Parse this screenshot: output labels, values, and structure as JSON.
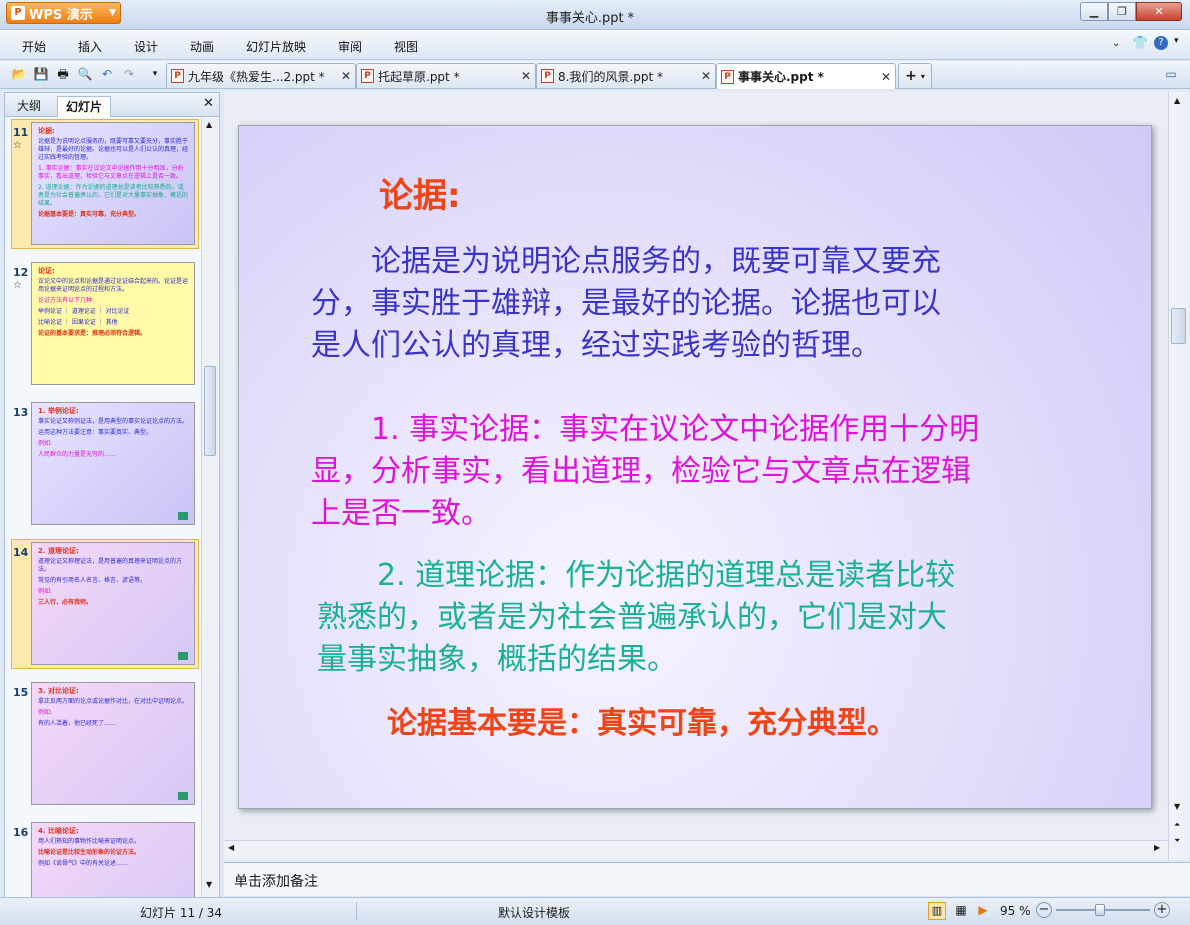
{
  "app": {
    "brand": "WPS 演示",
    "window_title": "事事关心.ppt *"
  },
  "menu": [
    "开始",
    "插入",
    "设计",
    "动画",
    "幻灯片放映",
    "审阅",
    "视图"
  ],
  "doc_tabs": [
    {
      "label": "九年级《热爱生...2.ppt *"
    },
    {
      "label": "托起草原.ppt *"
    },
    {
      "label": "8.我们的风景.ppt *"
    },
    {
      "label": "事事关心.ppt *",
      "active": true
    }
  ],
  "left_pane": {
    "tabs": [
      "大纲",
      "幻灯片"
    ],
    "thumbnails": [
      {
        "num": "11",
        "star": "☆",
        "selected": true,
        "lines": [
          {
            "c": "th",
            "t": "论据:"
          },
          {
            "c": "tb1",
            "t": "论据是为说明论点服务的，既要可靠又要充分，事实胜于雄辩，是最好的论据。论据也可以是人们公认的真理，经过实践考验的哲理。"
          },
          {
            "c": "tb2",
            "t": "1. 事实论据：事实在议论文中论据作用十分明显，分析事实，看出道理，检验它与文章点在逻辑上是否一致。"
          },
          {
            "c": "tb3",
            "t": "2. 道理论据：作为论据的道理总是读者比较熟悉的，或者是为社会普遍承认的，它们是对大量事实抽象，概括的结果。"
          },
          {
            "c": "tb4",
            "t": "论据基本要是：真实可靠，充分典型。"
          }
        ]
      },
      {
        "num": "12",
        "star": "☆",
        "lines": [
          {
            "c": "th",
            "t": "论证:"
          },
          {
            "c": "tb1",
            "t": "议论文中的论点和论据是通过论证结合起来的。论证是运用论据来证明论点的过程和方法。"
          },
          {
            "c": "tb2",
            "t": "论证方法有以下几种:"
          },
          {
            "c": "tb1",
            "t": "举例论证 ｜ 道理论证 ｜ 对比论证"
          },
          {
            "c": "tb1",
            "t": "比喻论证 ｜ 因果论证 ｜ 其他"
          },
          {
            "c": "tb4",
            "t": "论证的基本要求是：推理必须符合逻辑。"
          }
        ]
      },
      {
        "num": "13",
        "lines": [
          {
            "c": "th",
            "t": "1. 举例论证:"
          },
          {
            "c": "tb1",
            "t": "事实论证又称例证法，是用典型的事实论证论点的方法。"
          },
          {
            "c": "tb1",
            "t": "运用这种方法要注意：事实要真实、典型。"
          },
          {
            "c": "tb2",
            "t": "例如:"
          },
          {
            "c": "tb2",
            "t": "人民群众的力量是无穷的……"
          }
        ]
      },
      {
        "num": "14",
        "selected": true,
        "lines": [
          {
            "c": "th",
            "t": "2. 道理论证:"
          },
          {
            "c": "tb1",
            "t": "道理论证又称理证法，是用普遍的真理来证明论点的方法。"
          },
          {
            "c": "tb1",
            "t": "常见的有引用名人名言、格言、谚语等。"
          },
          {
            "c": "tb2",
            "t": "例如:"
          },
          {
            "c": "tb4",
            "t": "三人行，必有我师。"
          }
        ]
      },
      {
        "num": "15",
        "lines": [
          {
            "c": "th",
            "t": "3. 对比论证:"
          },
          {
            "c": "tb1",
            "t": "拿正反两方面的论点或论据作对比，在对比中证明论点。"
          },
          {
            "c": "tb2",
            "t": "例如:"
          },
          {
            "c": "tb1",
            "t": "有的人活着，他已经死了……"
          }
        ]
      },
      {
        "num": "16",
        "lines": [
          {
            "c": "th",
            "t": "4. 比喻论证:"
          },
          {
            "c": "tb1",
            "t": "用人们熟知的事物作比喻来证明论点。"
          },
          {
            "c": "tb4",
            "t": "比喻论证是比较生动形象的论证方法。"
          },
          {
            "c": "tb1",
            "t": "例如《谈骨气》中的有关论述……"
          }
        ]
      }
    ]
  },
  "slide": {
    "title": "论据:",
    "para1_lines": [
      "　　论据是为说明论点服务的，既要可靠又要充",
      "分，事实胜于雄辩，是最好的论据。论据也可以",
      "是人们公认的真理，经过实践考验的哲理。"
    ],
    "para2_lines": [
      "　　1. 事实论据：事实在议论文中论据作用十分明",
      "显，分析事实，看出道理，检验它与文章点在逻辑",
      "上是否一致。"
    ],
    "para3_lines": [
      "　　2. 道理论据：作为论据的道理总是读者比较",
      "熟悉的，或者是为社会普遍承认的，它们是对大",
      "量事实抽象，概括的结果。"
    ],
    "key_point": "论据基本要是：真实可靠，充分典型。"
  },
  "notes": {
    "placeholder": "单击添加备注"
  },
  "status": {
    "slide_info": "幻灯片 11 / 34",
    "template": "默认设计模板",
    "zoom": "95 %"
  },
  "colors": {
    "title": "#ef4516",
    "para1": "#3a34c8",
    "para2": "#e011d8",
    "para3": "#19b097"
  }
}
